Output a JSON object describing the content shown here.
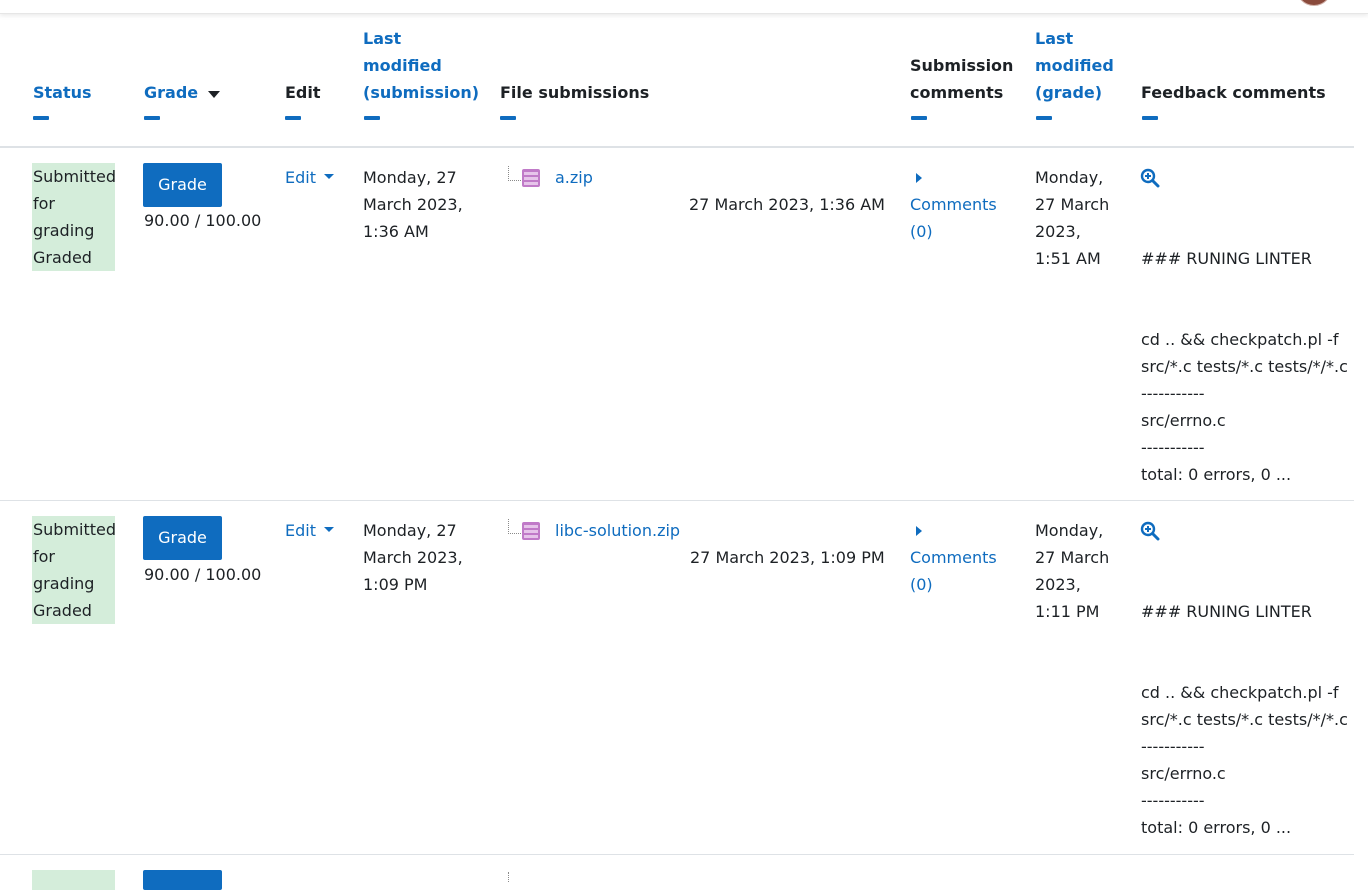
{
  "headers": {
    "status": "Status",
    "grade": "Grade",
    "edit": "Edit",
    "last_modified_submission": [
      "Last",
      "modified",
      "(submission)"
    ],
    "file_submissions": "File submissions",
    "submission_comments": [
      "Submission",
      "comments"
    ],
    "last_modified_grade": [
      "Last",
      "modified",
      "(grade)"
    ],
    "feedback_comments": "Feedback comments"
  },
  "rows": [
    {
      "status": [
        "Submitted",
        "for",
        "grading",
        "Graded"
      ],
      "grade_button": "Grade",
      "grade_value": "90.00 / 100.00",
      "edit_label": "Edit",
      "modified_submission": [
        "Monday, 27",
        "March 2023,",
        "1:36 AM"
      ],
      "file_name": "a.zip",
      "file_date": "27 March 2023, 1:36 AM",
      "comments_label": [
        "Comments",
        "(0)"
      ],
      "modified_grade": [
        "Monday,",
        "27 March",
        "2023,",
        "1:51 AM"
      ],
      "feedback": {
        "heading": "### RUNING LINTER",
        "lines": [
          "cd .. && checkpatch.pl -f",
          "src/*.c tests/*.c tests/*/*.c",
          "-----------",
          "src/errno.c",
          "-----------",
          "total: 0 errors, 0 ..."
        ]
      }
    },
    {
      "status": [
        "Submitted",
        "for",
        "grading",
        "Graded"
      ],
      "grade_button": "Grade",
      "grade_value": "90.00 / 100.00",
      "edit_label": "Edit",
      "modified_submission": [
        "Monday, 27",
        "March 2023,",
        "1:09 PM"
      ],
      "file_name": "libc-solution.zip",
      "file_date": "27 March 2023, 1:09 PM",
      "comments_label": [
        "Comments",
        "(0)"
      ],
      "modified_grade": [
        "Monday,",
        "27 March",
        "2023,",
        "1:11 PM"
      ],
      "feedback": {
        "heading": "### RUNING LINTER",
        "lines": [
          "cd .. && checkpatch.pl -f",
          "src/*.c tests/*.c tests/*/*.c",
          "-----------",
          "src/errno.c",
          "-----------",
          "total: 0 errors, 0 ..."
        ]
      }
    }
  ],
  "colors": {
    "link": "#0f6cbf",
    "status_bg": "#d4edda",
    "grade_button_bg": "#0f6cbf"
  },
  "icons": [
    "zip-file-icon",
    "expand-comments-icon",
    "zoom-in-icon",
    "sort-desc-icon",
    "dropdown-caret-icon"
  ]
}
